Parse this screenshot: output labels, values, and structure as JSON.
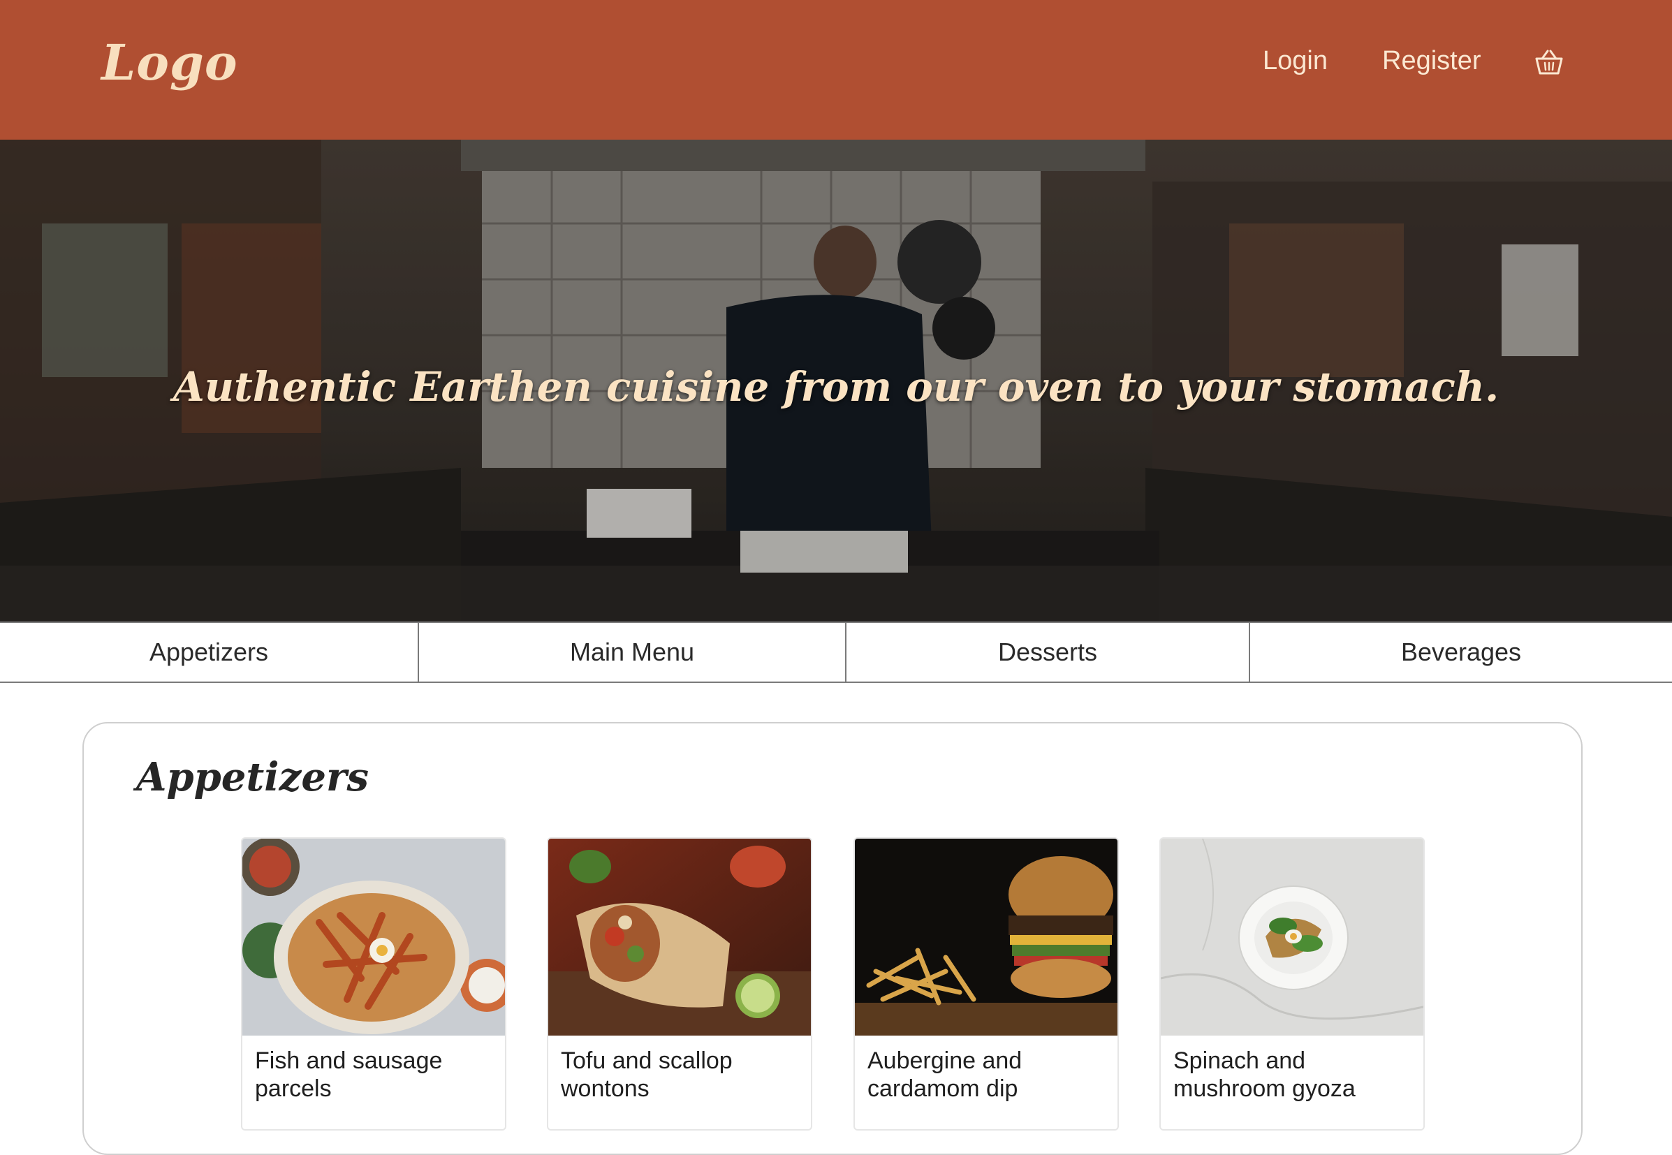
{
  "header": {
    "logo": "Logo",
    "nav": {
      "login": "Login",
      "register": "Register"
    },
    "cart_icon": "basket-icon",
    "background_color": "#b04f32",
    "text_color": "#fbe8d2"
  },
  "hero": {
    "headline": "Authentic Earthen cuisine from our oven to your stomach."
  },
  "tabs": [
    {
      "label": "Appetizers"
    },
    {
      "label": "Main Menu"
    },
    {
      "label": "Desserts"
    },
    {
      "label": "Beverages"
    }
  ],
  "menu_section": {
    "title": "Appetizers",
    "items": [
      {
        "name": "Fish and sausage parcels"
      },
      {
        "name": "Tofu and scallop wontons"
      },
      {
        "name": "Aubergine and cardamom dip"
      },
      {
        "name": "Spinach and mushroom gyoza"
      }
    ]
  }
}
